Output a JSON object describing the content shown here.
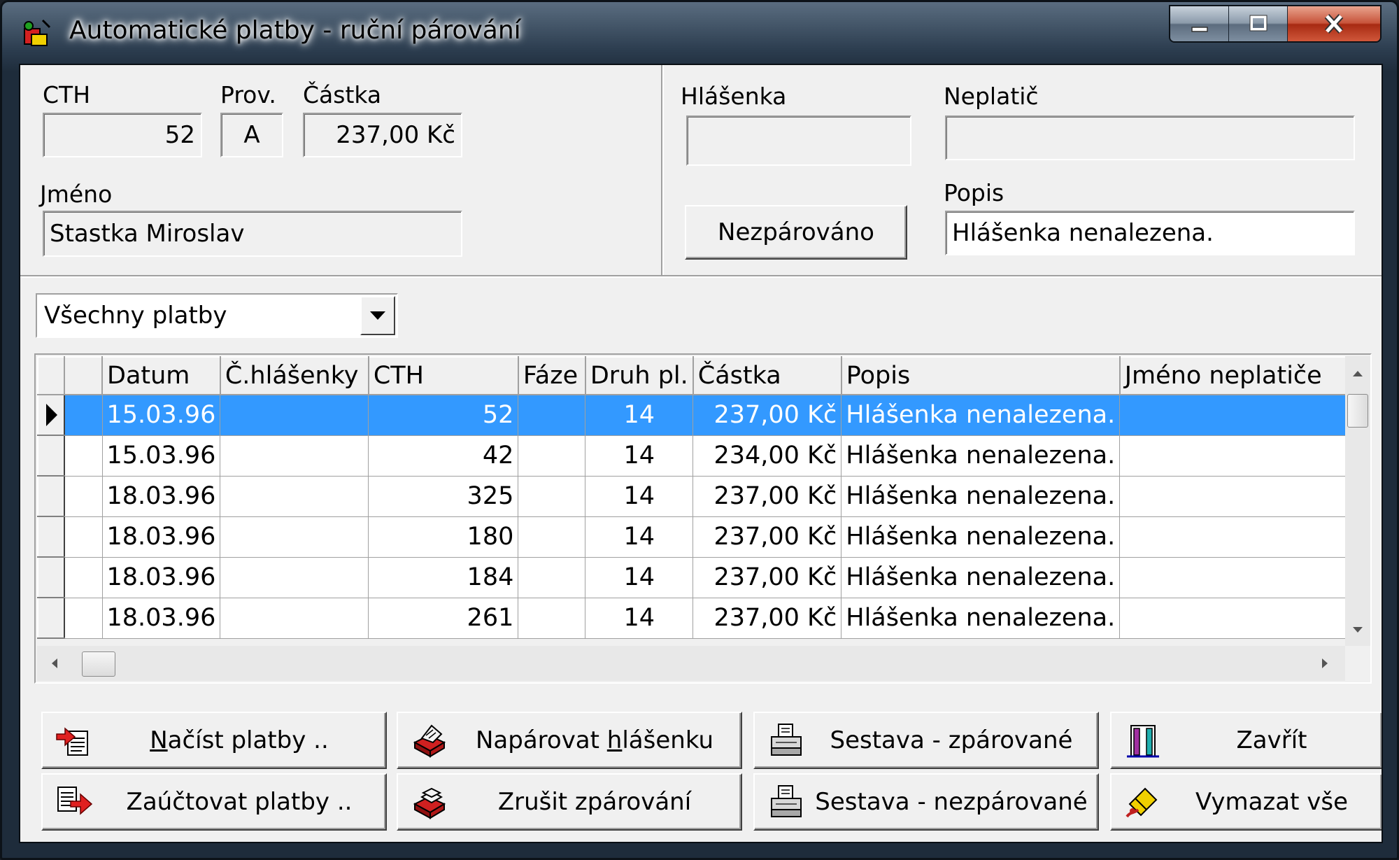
{
  "window": {
    "title": "Automatické platby - ruční párování",
    "colors": {
      "selection": "#3399ff",
      "close_button": "#c7533a"
    }
  },
  "header": {
    "cth_label": "CTH",
    "cth_value": "52",
    "prov_label": "Prov.",
    "prov_value": "A",
    "castka_label": "Částka",
    "castka_value": "237,00 Kč",
    "jmeno_label": "Jméno",
    "jmeno_value": "Stastka Miroslav",
    "hlasenka_label": "Hlášenka",
    "hlasenka_value": "",
    "neplatic_label": "Neplatič",
    "neplatic_value": "",
    "status_button": "Nezpárováno",
    "popis_label": "Popis",
    "popis_value": "Hlášenka nenalezena."
  },
  "filter": {
    "selected": "Všechny platby"
  },
  "grid": {
    "columns": [
      "",
      "Datum",
      "Č.hlášenky",
      "CTH",
      "Fáze",
      "Druh pl.",
      "Částka",
      "Popis",
      "Jméno neplatiče"
    ],
    "rows": [
      {
        "datum": "15.03.96",
        "hlasenka": "",
        "cth": "52",
        "faze": "",
        "druh": "14",
        "castka": "237,00 Kč",
        "popis": "Hlášenka nenalezena.",
        "jmeno": "",
        "selected": true
      },
      {
        "datum": "15.03.96",
        "hlasenka": "",
        "cth": "42",
        "faze": "",
        "druh": "14",
        "castka": "234,00 Kč",
        "popis": "Hlášenka nenalezena.",
        "jmeno": ""
      },
      {
        "datum": "18.03.96",
        "hlasenka": "",
        "cth": "325",
        "faze": "",
        "druh": "14",
        "castka": "237,00 Kč",
        "popis": "Hlášenka nenalezena.",
        "jmeno": ""
      },
      {
        "datum": "18.03.96",
        "hlasenka": "",
        "cth": "180",
        "faze": "",
        "druh": "14",
        "castka": "237,00 Kč",
        "popis": "Hlášenka nenalezena.",
        "jmeno": ""
      },
      {
        "datum": "18.03.96",
        "hlasenka": "",
        "cth": "184",
        "faze": "",
        "druh": "14",
        "castka": "237,00 Kč",
        "popis": "Hlášenka nenalezena.",
        "jmeno": ""
      },
      {
        "datum": "18.03.96",
        "hlasenka": "",
        "cth": "261",
        "faze": "",
        "druh": "14",
        "castka": "237,00 Kč",
        "popis": "Hlášenka nenalezena.",
        "jmeno": ""
      }
    ]
  },
  "buttons": {
    "nacist": {
      "pre": "",
      "key": "N",
      "post": "ačíst platby ..",
      "icon": "import-payments-icon"
    },
    "zauctovat": {
      "pre": "Zaúčtovat platby ..",
      "key": "",
      "post": "",
      "icon": "post-payments-icon"
    },
    "naparovat": {
      "pre": "Napárovat ",
      "key": "h",
      "post": "lášenku",
      "icon": "pair-report-icon"
    },
    "zrusit": {
      "pre": "Zrušit zpárování",
      "key": "",
      "post": "",
      "icon": "unpair-icon"
    },
    "sestava_zp": {
      "pre": "Sestava - zpárované",
      "key": "",
      "post": "",
      "icon": "printer-icon"
    },
    "sestava_nezp": {
      "pre": "Sestava - nezpárované",
      "key": "",
      "post": "",
      "icon": "printer-icon"
    },
    "zavrit": {
      "pre": "Zavřít",
      "key": "",
      "post": "",
      "icon": "door-exit-icon"
    },
    "vymazat": {
      "pre": "Vymazat vše",
      "key": "",
      "post": "",
      "icon": "eraser-icon"
    }
  }
}
